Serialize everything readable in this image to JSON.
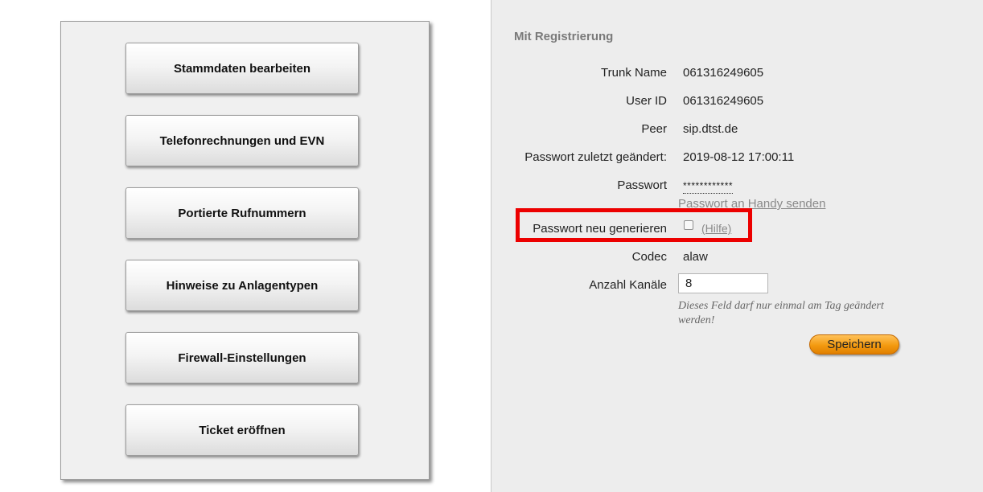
{
  "menu": {
    "items": [
      {
        "label": "Stammdaten bearbeiten"
      },
      {
        "label": "Telefonrechnungen und EVN"
      },
      {
        "label": "Portierte Rufnummern"
      },
      {
        "label": "Hinweise zu Anlagentypen"
      },
      {
        "label": "Firewall-Einstellungen"
      },
      {
        "label": "Ticket eröffnen"
      }
    ]
  },
  "form": {
    "section_title": "Mit Registrierung",
    "trunk_name": {
      "label": "Trunk Name",
      "value": "061316249605"
    },
    "user_id": {
      "label": "User ID",
      "value": "061316249605"
    },
    "peer": {
      "label": "Peer",
      "value": "sip.dtst.de"
    },
    "password_changed": {
      "label": "Passwort zuletzt geändert:",
      "value": "2019-08-12 17:00:11"
    },
    "password": {
      "label": "Passwort",
      "value": "************",
      "send_link": "Passwort an Handy senden"
    },
    "regenerate": {
      "label": "Passwort neu generieren",
      "checked": false,
      "help_link": "(Hilfe)"
    },
    "codec": {
      "label": "Codec",
      "value": "alaw"
    },
    "channels": {
      "label": "Anzahl Kanäle",
      "value": "8",
      "hint": "Dieses Feld darf nur einmal am Tag geändert werden!"
    },
    "save_label": "Speichern"
  },
  "colors": {
    "highlight": "#ec0000",
    "save_button": "#f39a10",
    "section_title": "#7a7a7a"
  }
}
